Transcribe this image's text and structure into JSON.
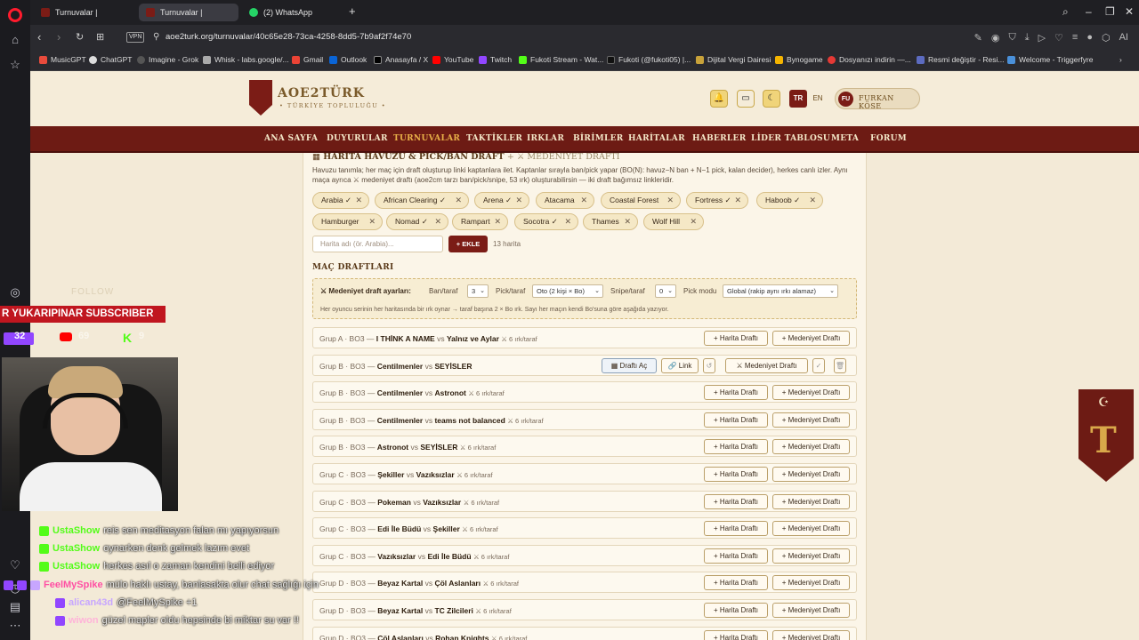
{
  "browser": {
    "tabs": [
      {
        "title": "Turnuvalar | AOE2TÜRK",
        "active": false
      },
      {
        "title": "Turnuvalar | AOE2TÜRK",
        "active": true
      },
      {
        "title": "(2) WhatsApp",
        "active": false
      }
    ],
    "new_tab": "+",
    "vpn_label": "VPN",
    "url": "aoe2turk.org/turnuvalar/40c65e28-73ca-4258-8dd5-7b9af2f74e70",
    "bookmarks": [
      "MusicGPT",
      "ChatGPT",
      "Imagine - Grok",
      "Whisk - labs.google/...",
      "Gmail",
      "Outlook",
      "Anasayfa / X",
      "YouTube",
      "Twitch",
      "Fukoti Stream - Wat...",
      "Fukoti (@fukoti05) |...",
      "Dijital Vergi Dairesi",
      "Bynogame",
      "Dosyanızı indirin —...",
      "Resmi değiştir - Resi...",
      "Welcome - Triggerfyre"
    ],
    "colors": {
      "opera_red": "#ff1b2d",
      "chrome_bg": "#2a2a2f"
    }
  },
  "site": {
    "logo_title": "AOE2TÜRK",
    "logo_sub": "• TÜRKİYE TOPLULUĞU •",
    "lang_tr": "TR",
    "lang_en": "EN",
    "user_initials": "FU",
    "user_name": "FURKAN KÖSE",
    "nav": [
      "ANA SAYFA",
      "DUYURULAR",
      "TURNUVALAR",
      "TAKTİKLER",
      "IRKLAR",
      "BİRİMLER",
      "HARİTALAR",
      "HABERLER",
      "LİDER TABLOSU",
      "META",
      "FORUM"
    ],
    "active_nav": "TURNUVALAR",
    "colors": {
      "nav_bg": "#6d1b14",
      "accent": "#7b1c16",
      "page_bg": "#f3ead7"
    }
  },
  "content": {
    "section_title": "HARİTA HAVUZU & PICK/BAN DRAFT",
    "section_title_extra": "+ ⚔ MEDENİYET DRAFTI",
    "description": "Havuzu tanımla; her maç için draft oluşturup linki kaptanlara ilet. Kaptanlar sırayla ban/pick yapar (BO(N): havuz−N ban + N−1 pick, kalan decider), herkes canlı izler. Aynı maça ayrıca ⚔ medeniyet draftı (aoe2cm tarzı ban/pick/snipe, 53 ırk) oluşturabilirsin — iki draft bağımsız linkleridir.",
    "maps": [
      "Arabia ✓",
      "African Clearing ✓",
      "Arena ✓",
      "Atacama",
      "Coastal Forest",
      "Fortress ✓",
      "Haboob ✓",
      "Hamburger",
      "Nomad ✓",
      "Rampart",
      "Socotra ✓",
      "Thames",
      "Wolf Hill"
    ],
    "chip_remove": "✕",
    "map_input_placeholder": "Harita adı (ör. Arabia)...",
    "add_button": "+ EKLE",
    "map_count": "13 harita",
    "drafts_heading": "MAÇ DRAFTLARI",
    "settings": {
      "title": "⚔ Medeniyet draft ayarları:",
      "ban_label": "Ban/taraf",
      "ban_value": "3",
      "pick_label": "Pick/taraf",
      "pick_value": "Oto (2 kişi × Bo)",
      "snipe_label": "Snipe/taraf",
      "snipe_value": "0",
      "mode_label": "Pick modu",
      "mode_value": "Global (rakip aynı ırkı alamaz)",
      "note": "Her oyuncu serinin her haritasında bir ırk oynar → taraf başına 2 × Bo ırk. Sayı her maçın kendi Bo'suna göre aşağıda yazıyor."
    },
    "matches": [
      {
        "group": "Grup A · BO3 — ",
        "t1": "I THİNK A NAME",
        "vs": " vs ",
        "t2": "Yalnız ve Aylar",
        "civ": "⚔ 6 ırk/taraf",
        "state": "new"
      },
      {
        "group": "Grup B · BO3 — ",
        "t1": "Centilmenler",
        "vs": " vs ",
        "t2": "SEYİSLER",
        "civ": "",
        "state": "open"
      },
      {
        "group": "Grup B · BO3 — ",
        "t1": "Centilmenler",
        "vs": " vs ",
        "t2": "Astronot",
        "civ": "⚔ 6 ırk/taraf",
        "state": "new"
      },
      {
        "group": "Grup B · BO3 — ",
        "t1": "Centilmenler",
        "vs": " vs ",
        "t2": "teams not balanced",
        "civ": "⚔ 6 ırk/taraf",
        "state": "new"
      },
      {
        "group": "Grup B · BO3 — ",
        "t1": "Astronot",
        "vs": " vs ",
        "t2": "SEYİSLER",
        "civ": "⚔ 6 ırk/taraf",
        "state": "new"
      },
      {
        "group": "Grup C · BO3 — ",
        "t1": "Şekiller",
        "vs": " vs ",
        "t2": "Vazıksızlar",
        "civ": "⚔ 6 ırk/taraf",
        "state": "new"
      },
      {
        "group": "Grup C · BO3 — ",
        "t1": "Pokeman",
        "vs": " vs ",
        "t2": "Vazıksızlar",
        "civ": "⚔ 6 ırk/taraf",
        "state": "new"
      },
      {
        "group": "Grup C · BO3 — ",
        "t1": "Edi İle Büdü",
        "vs": " vs ",
        "t2": "Şekiller",
        "civ": "⚔ 6 ırk/taraf",
        "state": "new"
      },
      {
        "group": "Grup C · BO3 — ",
        "t1": "Vazıksızlar",
        "vs": " vs ",
        "t2": "Edi İle Büdü",
        "civ": "⚔ 6 ırk/taraf",
        "state": "new"
      },
      {
        "group": "Grup D · BO3 — ",
        "t1": "Beyaz Kartal",
        "vs": " vs ",
        "t2": "Çöl Aslanları",
        "civ": "⚔ 6 ırk/taraf",
        "state": "new"
      },
      {
        "group": "Grup D · BO3 — ",
        "t1": "Beyaz Kartal",
        "vs": " vs ",
        "t2": "TC Zilcileri",
        "civ": "⚔ 6 ırk/taraf",
        "state": "new"
      },
      {
        "group": "Grup D · BO3 — ",
        "t1": "Çöl Aslanları",
        "vs": " vs ",
        "t2": "Rohan Knights",
        "civ": "⚔ 6 ırk/taraf",
        "state": "new"
      }
    ],
    "btn_map_draft": "+ Harita Draftı",
    "btn_civ_draft_new": "+ Medeniyet Draftı",
    "btn_open_draft": "Draftı Aç",
    "btn_link": "Link",
    "btn_civ_draft": "Medeniyet Draftı",
    "btn_reset": "↺",
    "btn_check": "✓",
    "btn_delete": "🗑"
  },
  "stream": {
    "faint_text": "FOLLOW",
    "subscriber_banner": "R YUKARIPINAR  SUBSCRIBER",
    "count_total": "32",
    "count_youtube": "69",
    "count_kick": "9",
    "chat": [
      {
        "user": "UstaShow",
        "msg": "reis sen meditasyon falan mı yapıyorsun",
        "color": "#53fc18"
      },
      {
        "user": "UstaShow",
        "msg": "oynarken denk gelmek lazım evet",
        "color": "#53fc18"
      },
      {
        "user": "UstaShow",
        "msg": "herkes asıl o zaman kendini belli ediyor",
        "color": "#53fc18"
      },
      {
        "user": "FeelMySpike",
        "msg": "mülo haklı ustay, banlasakta olur chat sağlığı için",
        "color": "#ff4fa3"
      },
      {
        "user": "alican43d",
        "msg": "@FeelMySpike +1",
        "color": "#c7a6ff"
      },
      {
        "user": "wiwon",
        "msg": "güzel mapler oldu hepsinde bi miktar su var !!",
        "color": "#ffb3d9"
      }
    ]
  }
}
